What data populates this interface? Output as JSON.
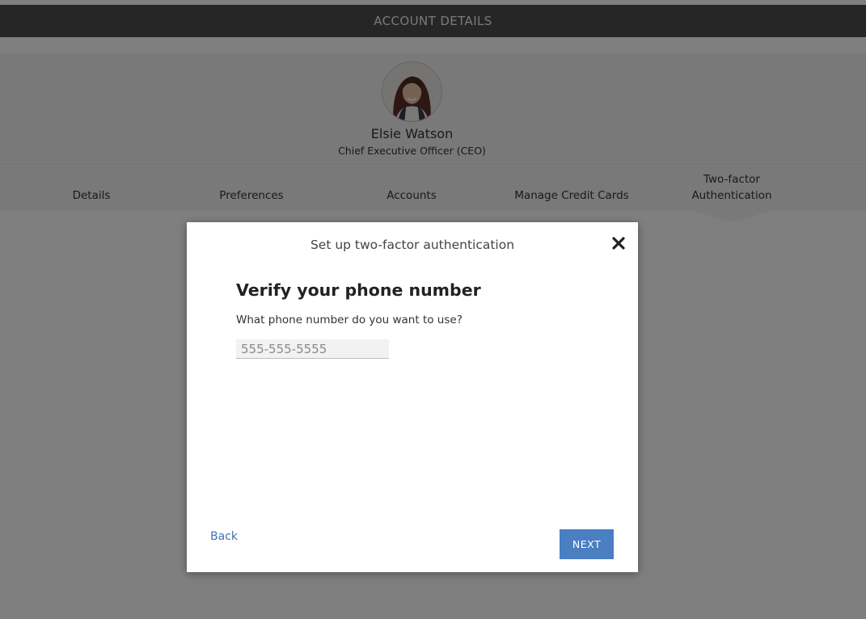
{
  "header": {
    "title": "ACCOUNT DETAILS"
  },
  "profile": {
    "name": "Elsie Watson",
    "job_title": "Chief Executive Officer (CEO)"
  },
  "tabs": [
    {
      "label": "Details"
    },
    {
      "label": "Preferences"
    },
    {
      "label": "Accounts"
    },
    {
      "label": "Manage Credit Cards"
    },
    {
      "label": "Two-factor Authentication",
      "active": true
    }
  ],
  "modal": {
    "title": "Set up two-factor authentication",
    "close_icon": "close-icon",
    "heading": "Verify your phone number",
    "question": "What phone number do you want to use?",
    "phone_input": {
      "value": "",
      "placeholder": "555-555-5555"
    },
    "back_label": "Back",
    "next_label": "NEXT"
  },
  "colors": {
    "header_bg": "#4d4d4d",
    "band_bg": "#f2f2f2",
    "accent": "#4a7fc1",
    "link": "#3e73b9",
    "overlay": "rgba(0,0,0,0.5)"
  }
}
